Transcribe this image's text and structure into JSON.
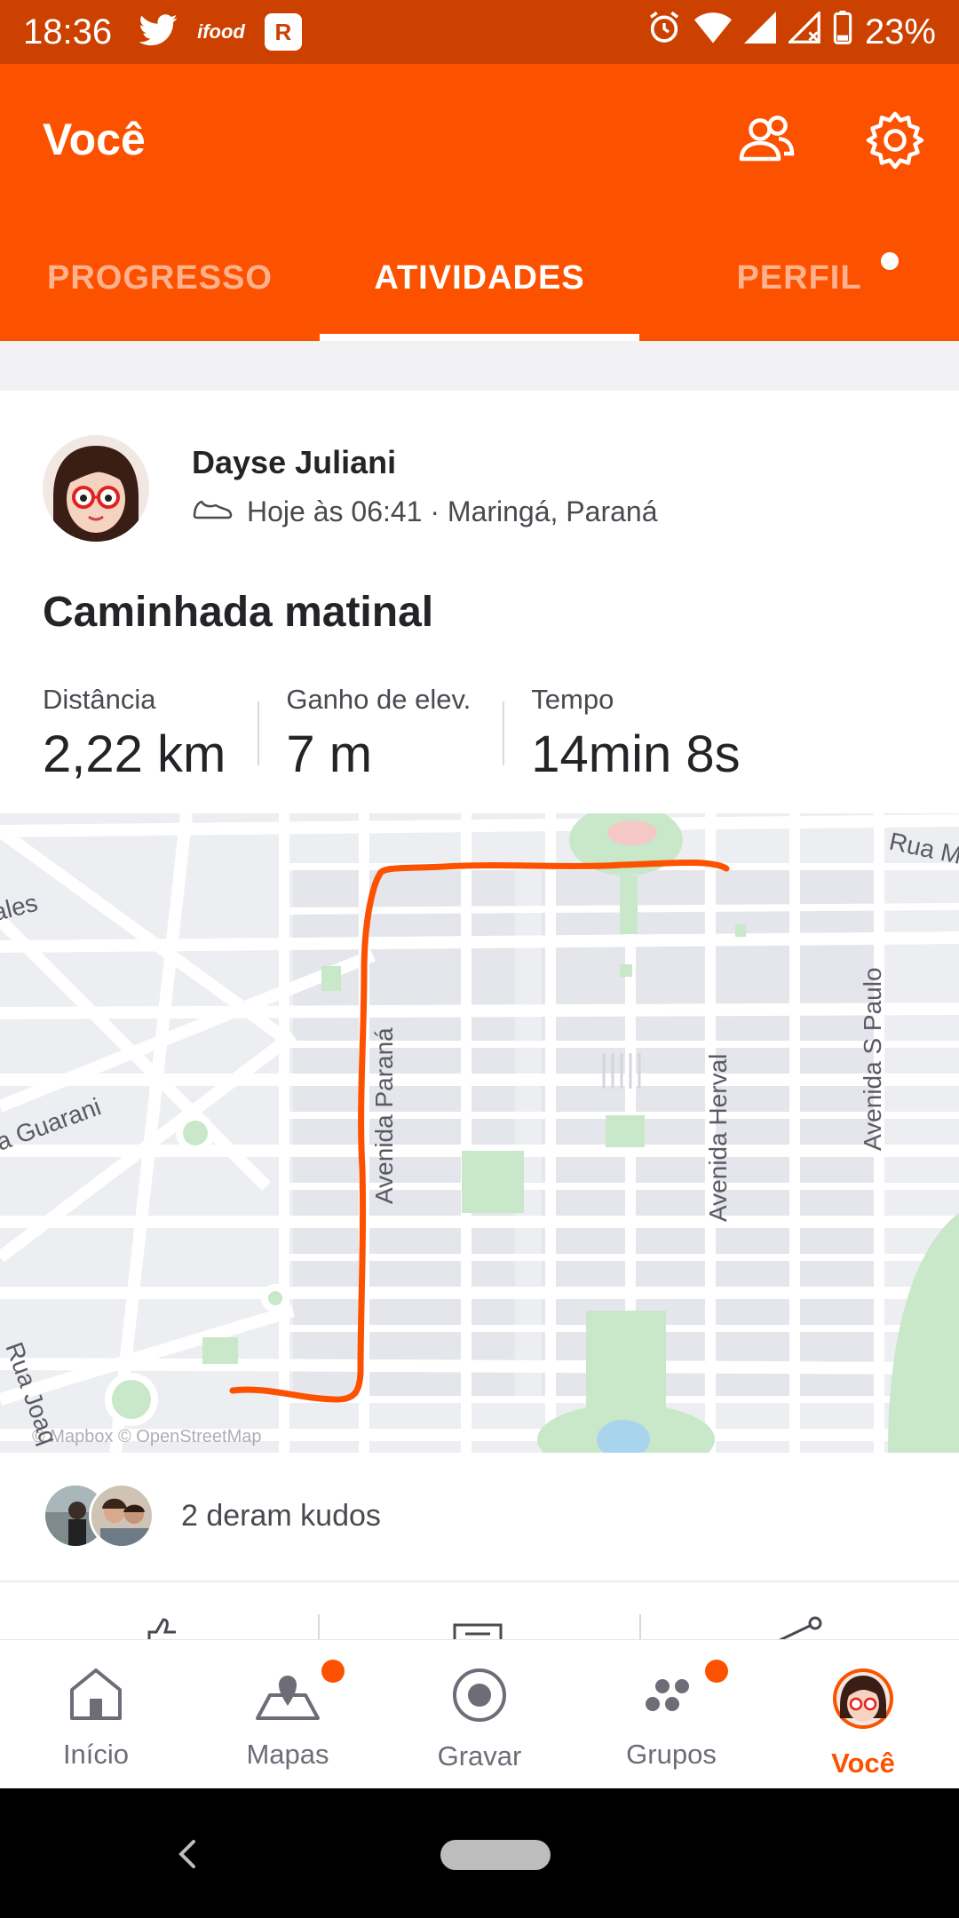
{
  "status_bar": {
    "time": "18:36",
    "ifood_label": "ifood",
    "app_badge": "R",
    "battery": "23%"
  },
  "header": {
    "title": "Você",
    "tabs": [
      {
        "label": "PROGRESSO",
        "active": false
      },
      {
        "label": "ATIVIDADES",
        "active": true
      },
      {
        "label": "PERFIL",
        "active": false
      }
    ]
  },
  "activity": {
    "athlete": "Dayse Juliani",
    "meta": "Hoje às 06:41 · Maringá, Paraná",
    "title": "Caminhada matinal",
    "stats": [
      {
        "label": "Distância",
        "value": "2,22 km"
      },
      {
        "label": "Ganho de elev.",
        "value": "7 m"
      },
      {
        "label": "Tempo",
        "value": "14min 8s"
      }
    ],
    "map": {
      "street_labels": [
        "Rua M",
        "ales",
        "a Guarani",
        "Avenida Paraná",
        "Avenida Herval",
        "Avenida S Paulo",
        "Rua Joaq"
      ],
      "attribution": "© Mapbox © OpenStreetMap",
      "route_color": "#fc5200"
    },
    "kudos_text": "2 deram kudos"
  },
  "bottom_nav": {
    "items": [
      {
        "label": "Início",
        "icon": "home-icon",
        "active": false
      },
      {
        "label": "Mapas",
        "icon": "map-pin-icon",
        "active": false
      },
      {
        "label": "Gravar",
        "icon": "record-icon",
        "active": false
      },
      {
        "label": "Grupos",
        "icon": "groups-icon",
        "active": false
      },
      {
        "label": "Você",
        "icon": "profile-avatar-icon",
        "active": true
      }
    ]
  },
  "colors": {
    "brand": "#fc5200",
    "status_bar": "#cc4100",
    "text_dark": "#242428"
  }
}
